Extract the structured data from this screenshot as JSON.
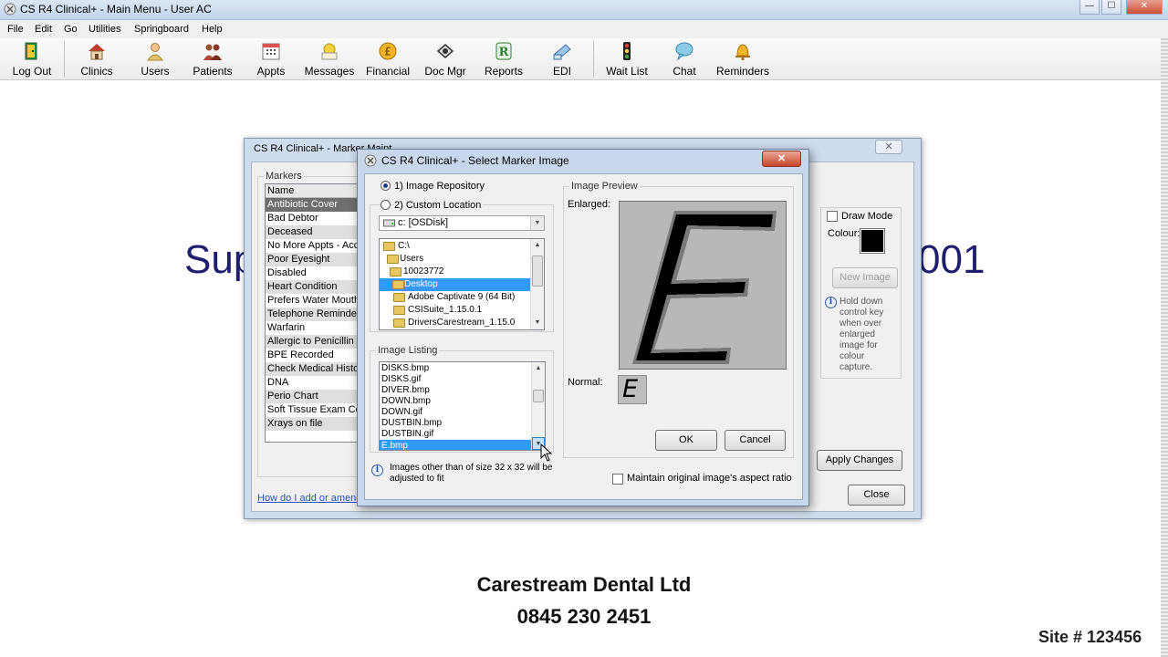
{
  "window": {
    "title": "CS R4 Clinical+ - Main Menu - User AC"
  },
  "menu": {
    "items": [
      {
        "label": "File"
      },
      {
        "label": "Edit"
      },
      {
        "label": "Go"
      },
      {
        "label": "Utilities"
      },
      {
        "label": "Springboard"
      },
      {
        "label": "Help"
      }
    ]
  },
  "toolbar": {
    "items": [
      {
        "label": "Log Out",
        "icon": "exit-door-icon"
      },
      {
        "label": "Clinics",
        "icon": "clinic-house-icon"
      },
      {
        "label": "Users",
        "icon": "user-icon"
      },
      {
        "label": "Patients",
        "icon": "patients-icon"
      },
      {
        "label": "Appts",
        "icon": "calendar-icon"
      },
      {
        "label": "Messages",
        "icon": "messages-icon"
      },
      {
        "label": "Financial",
        "icon": "pound-coin-icon"
      },
      {
        "label": "Doc Mgr",
        "icon": "document-manager-icon"
      },
      {
        "label": "Reports",
        "icon": "reports-icon"
      },
      {
        "label": "EDI",
        "icon": "edi-icon"
      },
      {
        "label": "Wait List",
        "icon": "traffic-light-icon"
      },
      {
        "label": "Chat",
        "icon": "chat-bubble-icon"
      },
      {
        "label": "Reminders",
        "icon": "bell-icon"
      }
    ]
  },
  "background": {
    "banner_left": "Sup",
    "banner_right": "001",
    "company": "Carestream Dental Ltd",
    "phone": "0845 230 2451",
    "site": "Site # 123456"
  },
  "maintenance": {
    "title": "CS R4 Clinical+ - Marker Maint",
    "markers_group": "Markers",
    "list_header": "Name",
    "markers": [
      "Antibiotic Cover",
      "Bad Debtor",
      "Deceased",
      "No More Appts - Acct",
      "Poor Eyesight",
      "Disabled",
      "Heart Condition",
      "Prefers Water Mouthwash",
      "Telephone Reminder",
      "Warfarin",
      "Allergic to Penicillin",
      "BPE Recorded",
      "Check Medical History",
      "DNA",
      "Perio Chart",
      "Soft Tissue Exam Complete",
      "Xrays on file"
    ],
    "help_link": "How do I add or amend",
    "draw_mode": "Draw Mode",
    "colour_label": "Colour:",
    "colour": "#000000",
    "new_image": "New Image",
    "hint": "Hold down control key when over enlarged image for colour capture.",
    "apply_changes": "Apply Changes",
    "close": "Close"
  },
  "dialog": {
    "title": "CS R4 Clinical+ - Select Marker Image",
    "option_repository": "1) Image Repository",
    "option_custom": "2) Custom Location",
    "drive": "c: [OSDisk]",
    "folders": [
      {
        "name": "C:\\"
      },
      {
        "name": "Users"
      },
      {
        "name": "10023772"
      },
      {
        "name": "Desktop"
      },
      {
        "name": "Adobe Captivate 9 (64 Bit)"
      },
      {
        "name": "CSISuite_1.15.0.1"
      },
      {
        "name": "DriversCarestream_1.15.0"
      }
    ],
    "image_listing_label": "Image Listing",
    "images": [
      "DISKS.bmp",
      "DISKS.gif",
      "DIVER.bmp",
      "DOWN.bmp",
      "DOWN.gif",
      "DUSTBIN.bmp",
      "DUSTBIN.gif",
      "E.bmp"
    ],
    "size_note": "Images other than of size 32 x 32 will be adjusted to fit",
    "preview_label": "Image Preview",
    "enlarged_label": "Enlarged:",
    "normal_label": "Normal:",
    "preview_glyph": "E",
    "ok": "OK",
    "cancel": "Cancel",
    "aspect_ratio": "Maintain original image's aspect ratio"
  }
}
